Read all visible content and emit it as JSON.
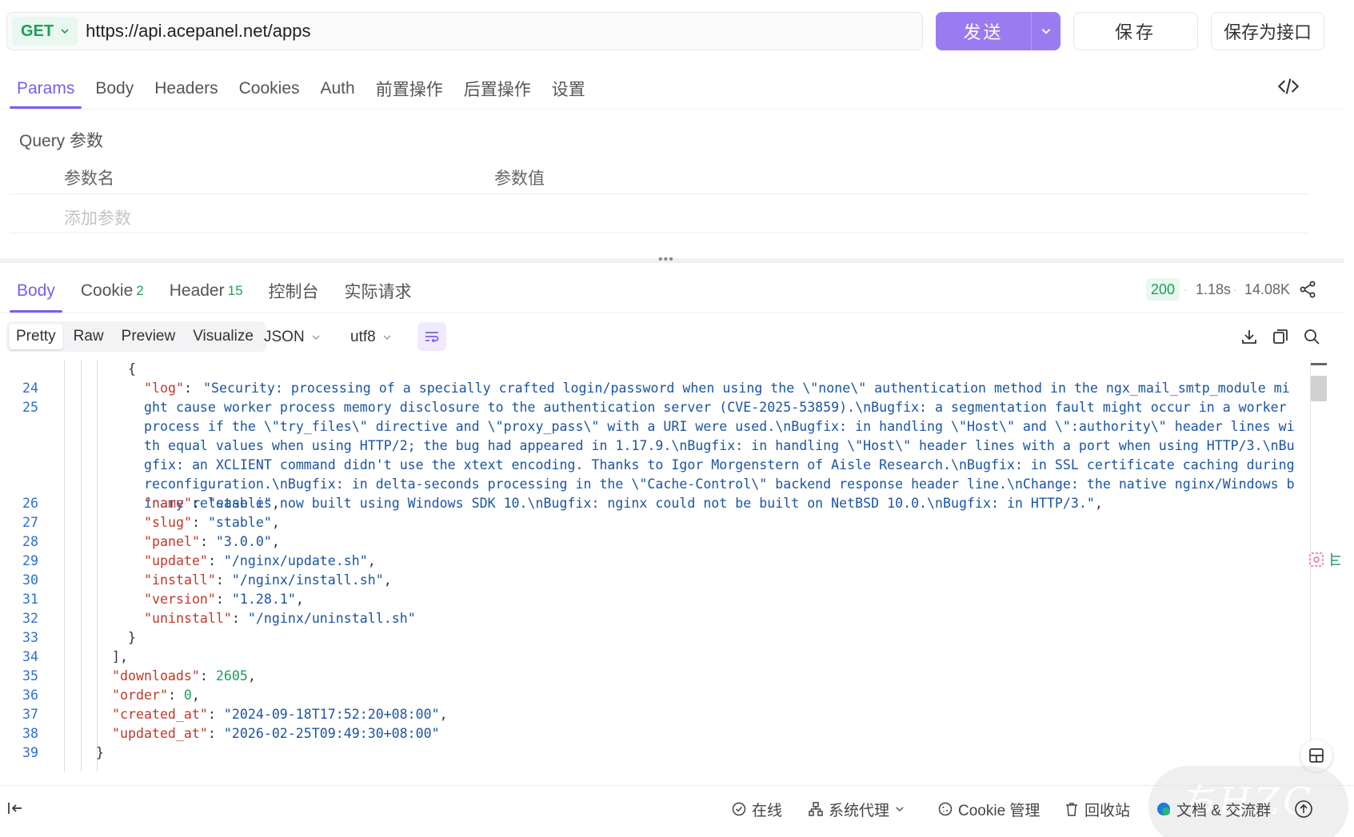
{
  "request": {
    "method": "GET",
    "url": "https://api.acepanel.net/apps",
    "send_label": "发送",
    "save_label": "保存",
    "save_api_label": "保存为接口"
  },
  "request_tabs": [
    "Params",
    "Body",
    "Headers",
    "Cookies",
    "Auth",
    "前置操作",
    "后置操作",
    "设置"
  ],
  "active_request_tab": "Params",
  "params": {
    "section_title": "Query 参数",
    "col_name": "参数名",
    "col_value": "参数值",
    "add_placeholder": "添加参数"
  },
  "response_tabs": [
    {
      "label": "Body",
      "count": ""
    },
    {
      "label": "Cookie",
      "count": "2"
    },
    {
      "label": "Header",
      "count": "15"
    },
    {
      "label": "控制台",
      "count": ""
    },
    {
      "label": "实际请求",
      "count": ""
    }
  ],
  "response_status": {
    "code": "200",
    "time": "1.18s",
    "size": "14.08K"
  },
  "view_modes": [
    "Pretty",
    "Raw",
    "Preview",
    "Visualize"
  ],
  "active_view_mode": "Pretty",
  "format": "JSON",
  "encoding": "utf8",
  "code": {
    "line_numbers": [
      "24",
      "25",
      "26",
      "27",
      "28",
      "29",
      "30",
      "31",
      "32",
      "33",
      "34",
      "35",
      "36",
      "37",
      "38",
      "39"
    ],
    "log_text": "\"Security: processing of a specially crafted login/password when using the \\\"none\\\" authentication method in the ngx_mail_smtp_module might cause worker process memory disclosure to the authentication server (CVE-2025-53859).\\nBugfix: a segmentation fault might occur in a worker process if the \\\"try_files\\\" directive and \\\"proxy_pass\\\" with a URI were used.\\nBugfix: in handling \\\"Host\\\" and \\\":authority\\\" header lines with equal values when using HTTP/2; the bug had appeared in 1.17.9.\\nBugfix: in handling \\\"Host\\\" header lines with a port when using HTTP/3.\\nBugfix: an XCLIENT command didn't use the xtext encoding. Thanks to Igor Morgenstern of Aisle Research.\\nBugfix: in SSL certificate caching during reconfiguration.\\nBugfix: in delta-seconds processing in the \\\"Cache-Control\\\" backend response header line.\\nChange: the native nginx/Windows binary release is now built using Windows SDK 10.\\nBugfix: nginx could not be built on NetBSD 10.0.\\nBugfix: in HTTP/3.\"",
    "entries": [
      {
        "key": "\"name\"",
        "value": "\"stable\"",
        "type": "s"
      },
      {
        "key": "\"slug\"",
        "value": "\"stable\"",
        "type": "s"
      },
      {
        "key": "\"panel\"",
        "value": "\"3.0.0\"",
        "type": "s"
      },
      {
        "key": "\"update\"",
        "value": "\"/nginx/update.sh\"",
        "type": "s"
      },
      {
        "key": "\"install\"",
        "value": "\"/nginx/install.sh\"",
        "type": "s"
      },
      {
        "key": "\"version\"",
        "value": "\"1.28.1\"",
        "type": "s"
      },
      {
        "key": "\"uninstall\"",
        "value": "\"/nginx/uninstall.sh\"",
        "type": "s"
      }
    ],
    "outer_entries": [
      {
        "key": "\"downloads\"",
        "value": "2605",
        "type": "n"
      },
      {
        "key": "\"order\"",
        "value": "0",
        "type": "n"
      },
      {
        "key": "\"created_at\"",
        "value": "\"2024-09-18T17:52:20+08:00\"",
        "type": "s"
      },
      {
        "key": "\"updated_at\"",
        "value": "\"2026-02-25T09:49:30+08:00\"",
        "type": "s"
      }
    ]
  },
  "footer": {
    "online": "在线",
    "proxy": "系统代理",
    "cookie_mgr": "Cookie 管理",
    "recycle": "回收站",
    "docs": "文档 & 交流群"
  },
  "colors": {
    "accent": "#7b5cf0",
    "send": "#9b7bf0",
    "success": "#1f9d55",
    "string": "#1b55a3",
    "key": "#c0392b"
  }
}
